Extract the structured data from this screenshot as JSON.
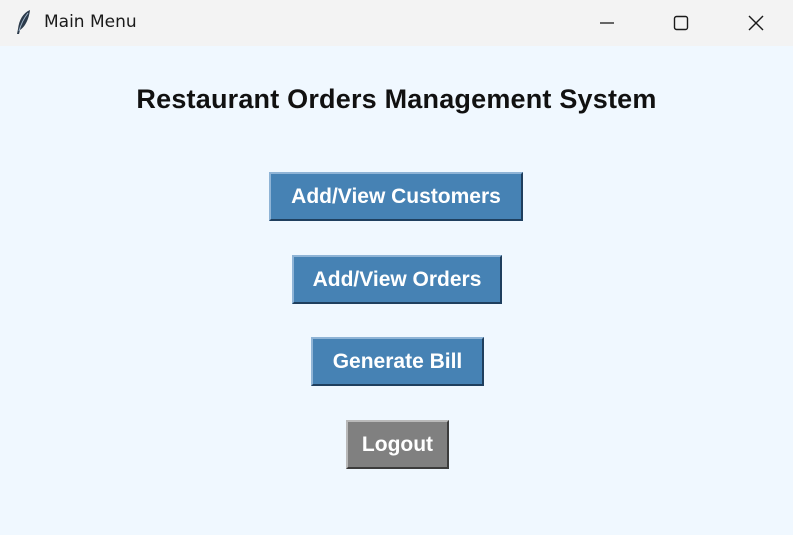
{
  "window": {
    "title": "Main Menu",
    "icon": "feather-icon",
    "controls": [
      "minimize-icon",
      "maximize-icon",
      "close-icon"
    ]
  },
  "main": {
    "heading": "Restaurant Orders Management System",
    "buttons": [
      {
        "label": "Add/View Customers",
        "color": "#4682b4"
      },
      {
        "label": "Add/View Orders",
        "color": "#4682b4"
      },
      {
        "label": "Generate Bill",
        "color": "#4682b4"
      },
      {
        "label": "Logout",
        "color": "#808080"
      }
    ]
  },
  "colors": {
    "background": "#f0f8ff",
    "titlebar": "#f3f3f3",
    "heading_text": "#111111",
    "button_text": "#ffffff"
  }
}
